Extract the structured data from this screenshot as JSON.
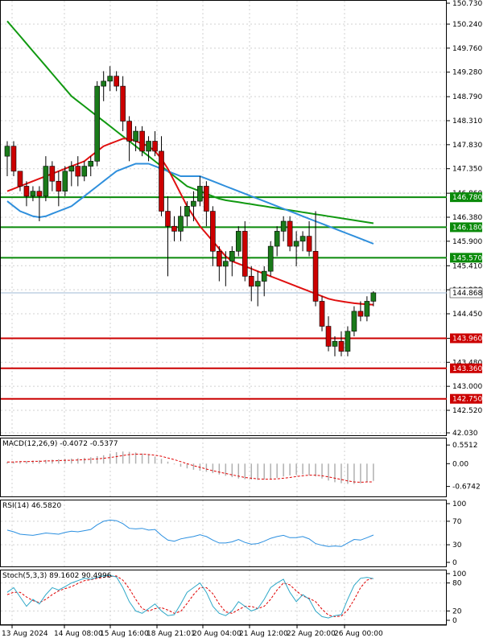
{
  "colors": {
    "bull": "#1a7a1a",
    "bear": "#cc0000",
    "ma_fast": "#e01010",
    "ma_mid": "#2f8fdc",
    "ma_slow": "#119911",
    "resistance": "#0a8a0a",
    "support": "#cc0000",
    "current_price": "#9fb8d6",
    "rsi_line": "#2a8fe0",
    "stoch_main": "#2fa8c8",
    "stoch_signal": "#e00000",
    "macd_hist": "#b0b0b0",
    "macd_signal": "#e00000",
    "grid": "#d0d0d0"
  },
  "chart_data": [
    {
      "type": "candlestick",
      "pane": "price",
      "ylim": [
        42.03,
        150.73
      ],
      "y_ticks": [
        "150.730",
        "150.240",
        "149.760",
        "149.280",
        "148.790",
        "148.310",
        "147.830",
        "147.350",
        "146.860",
        "146.380",
        "145.900",
        "145.410",
        "144.930",
        "144.450",
        "143.960",
        "143.480",
        "143.000",
        "142.520",
        "42.030"
      ],
      "x_labels": [
        "13 Aug 2024",
        "14 Aug 08:00",
        "15 Aug 16:00",
        "18 Aug 21:01",
        "20 Aug 04:00",
        "21 Aug 12:00",
        "22 Aug 20:00",
        "26 Aug 00:00"
      ],
      "candles": [
        [
          147.6,
          147.9,
          147.2,
          147.8
        ],
        [
          147.8,
          147.9,
          147.2,
          147.3
        ],
        [
          147.3,
          147.3,
          146.9,
          147.0
        ],
        [
          147.0,
          147.1,
          146.6,
          146.8
        ],
        [
          146.8,
          147.0,
          146.7,
          146.9
        ],
        [
          146.9,
          147.0,
          146.3,
          146.8
        ],
        [
          146.8,
          147.6,
          146.7,
          147.4
        ],
        [
          147.4,
          147.5,
          146.9,
          147.1
        ],
        [
          147.1,
          147.3,
          146.6,
          146.9
        ],
        [
          146.9,
          147.4,
          146.8,
          147.3
        ],
        [
          147.3,
          147.5,
          147.0,
          147.4
        ],
        [
          147.4,
          147.6,
          147.0,
          147.2
        ],
        [
          147.2,
          147.5,
          147.1,
          147.4
        ],
        [
          147.4,
          147.6,
          147.2,
          147.5
        ],
        [
          147.5,
          149.1,
          147.4,
          149.0
        ],
        [
          149.0,
          149.3,
          148.7,
          149.1
        ],
        [
          149.1,
          149.4,
          148.9,
          149.2
        ],
        [
          149.2,
          149.3,
          148.9,
          149.0
        ],
        [
          149.0,
          149.2,
          148.1,
          148.3
        ],
        [
          148.3,
          148.4,
          147.5,
          147.9
        ],
        [
          147.9,
          148.2,
          147.7,
          148.1
        ],
        [
          148.1,
          148.2,
          147.6,
          147.7
        ],
        [
          147.7,
          148.0,
          147.5,
          147.9
        ],
        [
          147.9,
          148.1,
          147.6,
          147.7
        ],
        [
          147.7,
          148.0,
          146.4,
          146.5
        ],
        [
          146.5,
          146.8,
          145.2,
          146.2
        ],
        [
          146.2,
          146.4,
          145.9,
          146.1
        ],
        [
          146.1,
          146.6,
          145.9,
          146.4
        ],
        [
          146.4,
          146.7,
          146.2,
          146.6
        ],
        [
          146.6,
          146.9,
          146.3,
          146.7
        ],
        [
          146.7,
          147.2,
          146.6,
          147.0
        ],
        [
          147.0,
          147.1,
          146.2,
          146.5
        ],
        [
          146.5,
          146.6,
          145.4,
          145.7
        ],
        [
          145.7,
          145.8,
          145.1,
          145.4
        ],
        [
          145.4,
          145.7,
          145.0,
          145.5
        ],
        [
          145.5,
          145.8,
          145.2,
          145.7
        ],
        [
          145.7,
          146.2,
          145.6,
          146.1
        ],
        [
          146.1,
          146.3,
          145.1,
          145.2
        ],
        [
          145.2,
          145.4,
          144.7,
          145.0
        ],
        [
          145.0,
          145.3,
          144.6,
          145.1
        ],
        [
          145.1,
          145.4,
          144.8,
          145.3
        ],
        [
          145.3,
          145.9,
          145.2,
          145.8
        ],
        [
          145.8,
          146.2,
          145.6,
          146.1
        ],
        [
          146.1,
          146.4,
          145.9,
          146.3
        ],
        [
          146.3,
          146.4,
          145.7,
          145.8
        ],
        [
          145.8,
          146.1,
          145.4,
          145.9
        ],
        [
          145.9,
          146.1,
          145.7,
          146.0
        ],
        [
          146.0,
          146.3,
          145.6,
          145.7
        ],
        [
          145.7,
          146.5,
          144.6,
          144.7
        ],
        [
          144.7,
          144.8,
          144.1,
          144.2
        ],
        [
          144.2,
          144.4,
          143.7,
          143.8
        ],
        [
          143.8,
          144.0,
          143.6,
          143.9
        ],
        [
          143.9,
          144.1,
          143.6,
          143.7
        ],
        [
          143.7,
          144.2,
          143.6,
          144.1
        ],
        [
          144.1,
          144.6,
          144.0,
          144.5
        ],
        [
          144.5,
          144.7,
          144.3,
          144.4
        ],
        [
          144.4,
          144.8,
          144.3,
          144.7
        ],
        [
          144.7,
          144.9,
          144.6,
          144.87
        ]
      ],
      "ma_fast": [
        146.9,
        146.95,
        147.0,
        147.05,
        147.1,
        147.15,
        147.2,
        147.25,
        147.3,
        147.35,
        147.4,
        147.45,
        147.5,
        147.6,
        147.7,
        147.8,
        147.85,
        147.9,
        147.95,
        147.95,
        147.9,
        147.85,
        147.8,
        147.7,
        147.55,
        147.35,
        147.1,
        146.85,
        146.6,
        146.4,
        146.2,
        146.05,
        145.9,
        145.75,
        145.6,
        145.5,
        145.45,
        145.4,
        145.35,
        145.3,
        145.25,
        145.2,
        145.15,
        145.1,
        145.05,
        145.0,
        144.95,
        144.9,
        144.85,
        144.8,
        144.75,
        144.72,
        144.7,
        144.68,
        144.66,
        144.65,
        144.64,
        144.63
      ],
      "ma_mid": [
        146.7,
        146.6,
        146.5,
        146.45,
        146.4,
        146.38,
        146.4,
        146.45,
        146.5,
        146.55,
        146.6,
        146.7,
        146.8,
        146.9,
        147.0,
        147.1,
        147.2,
        147.3,
        147.35,
        147.4,
        147.45,
        147.45,
        147.45,
        147.4,
        147.35,
        147.3,
        147.25,
        147.2,
        147.2,
        147.2,
        147.2,
        147.15,
        147.1,
        147.05,
        147.0,
        146.95,
        146.9,
        146.85,
        146.8,
        146.75,
        146.7,
        146.65,
        146.6,
        146.55,
        146.5,
        146.45,
        146.4,
        146.35,
        146.3,
        146.25,
        146.2,
        146.15,
        146.1,
        146.05,
        146.0,
        145.95,
        145.9,
        145.85
      ],
      "ma_slow": [
        150.3,
        150.15,
        150.0,
        149.85,
        149.7,
        149.55,
        149.4,
        149.25,
        149.1,
        148.95,
        148.8,
        148.7,
        148.6,
        148.5,
        148.4,
        148.3,
        148.2,
        148.1,
        148.0,
        147.9,
        147.8,
        147.7,
        147.6,
        147.5,
        147.4,
        147.3,
        147.2,
        147.1,
        147.0,
        146.95,
        146.9,
        146.85,
        146.8,
        146.75,
        146.72,
        146.7,
        146.68,
        146.66,
        146.64,
        146.62,
        146.6,
        146.58,
        146.56,
        146.54,
        146.52,
        146.5,
        146.48,
        146.46,
        146.44,
        146.42,
        146.4,
        146.38,
        146.36,
        146.34,
        146.32,
        146.3,
        146.28,
        146.26
      ],
      "levels": [
        {
          "label": "146.780",
          "value": 146.78,
          "kind": "resistance"
        },
        {
          "label": "146.180",
          "value": 146.18,
          "kind": "resistance"
        },
        {
          "label": "145.570",
          "value": 145.57,
          "kind": "resistance"
        },
        {
          "label": "143.960",
          "value": 143.96,
          "kind": "support"
        },
        {
          "label": "143.360",
          "value": 143.36,
          "kind": "support"
        },
        {
          "label": "142.750",
          "value": 142.75,
          "kind": "support"
        }
      ],
      "current_price": {
        "label": "144.868",
        "value": 144.868
      }
    },
    {
      "type": "macd",
      "pane": "macd",
      "title": "MACD(12,26,9) -0.4072 -0.5377",
      "y_ticks": [
        "0.5512",
        "0.00",
        "-0.6742"
      ],
      "ylim": [
        -0.85,
        0.65
      ],
      "hist": [
        0.05,
        0.06,
        0.07,
        0.08,
        0.09,
        0.1,
        0.11,
        0.12,
        0.13,
        0.14,
        0.15,
        0.16,
        0.17,
        0.19,
        0.22,
        0.25,
        0.3,
        0.34,
        0.36,
        0.35,
        0.33,
        0.3,
        0.26,
        0.21,
        0.14,
        0.06,
        -0.02,
        -0.09,
        -0.14,
        -0.18,
        -0.21,
        -0.24,
        -0.28,
        -0.32,
        -0.36,
        -0.4,
        -0.44,
        -0.46,
        -0.47,
        -0.48,
        -0.47,
        -0.45,
        -0.42,
        -0.38,
        -0.35,
        -0.33,
        -0.32,
        -0.34,
        -0.38,
        -0.44,
        -0.5,
        -0.55,
        -0.58,
        -0.6,
        -0.6,
        -0.58,
        -0.55,
        -0.51
      ],
      "signal": [
        0.05,
        0.05,
        0.06,
        0.06,
        0.07,
        0.07,
        0.08,
        0.08,
        0.09,
        0.1,
        0.1,
        0.11,
        0.12,
        0.13,
        0.14,
        0.16,
        0.18,
        0.21,
        0.24,
        0.27,
        0.28,
        0.28,
        0.27,
        0.25,
        0.22,
        0.17,
        0.12,
        0.06,
        0.0,
        -0.06,
        -0.11,
        -0.16,
        -0.21,
        -0.25,
        -0.29,
        -0.33,
        -0.37,
        -0.41,
        -0.43,
        -0.45,
        -0.46,
        -0.46,
        -0.45,
        -0.43,
        -0.41,
        -0.38,
        -0.36,
        -0.34,
        -0.34,
        -0.36,
        -0.39,
        -0.43,
        -0.47,
        -0.51,
        -0.54,
        -0.55,
        -0.54,
        -0.54
      ]
    },
    {
      "type": "line",
      "pane": "rsi",
      "title": "RSI(14) 46.5820",
      "y_ticks": [
        "100",
        "70",
        "30",
        "0"
      ],
      "ylim": [
        0,
        100
      ],
      "values": [
        55,
        52,
        48,
        47,
        46,
        48,
        50,
        49,
        48,
        51,
        53,
        52,
        54,
        56,
        64,
        70,
        72,
        71,
        66,
        58,
        57,
        58,
        55,
        56,
        46,
        38,
        36,
        40,
        42,
        44,
        47,
        44,
        38,
        33,
        33,
        35,
        39,
        34,
        31,
        32,
        36,
        41,
        44,
        46,
        42,
        42,
        44,
        40,
        32,
        29,
        27,
        28,
        27,
        33,
        39,
        38,
        42,
        46.58
      ]
    },
    {
      "type": "line",
      "pane": "stoch",
      "title": "Stoch(5,3,3) 89.1602 90.4996",
      "y_ticks": [
        "100",
        "80",
        "20",
        "0"
      ],
      "ylim": [
        0,
        100
      ],
      "main": [
        60,
        70,
        50,
        30,
        45,
        35,
        55,
        70,
        65,
        72,
        80,
        85,
        90,
        88,
        92,
        95,
        96,
        93,
        70,
        40,
        20,
        15,
        25,
        35,
        20,
        10,
        12,
        35,
        60,
        70,
        80,
        60,
        30,
        15,
        10,
        20,
        40,
        30,
        20,
        25,
        45,
        70,
        80,
        88,
        60,
        40,
        55,
        45,
        20,
        8,
        5,
        10,
        12,
        45,
        75,
        90,
        92,
        89.16
      ],
      "signal": [
        55,
        60,
        60,
        50,
        42,
        38,
        45,
        55,
        63,
        68,
        72,
        79,
        85,
        87,
        90,
        92,
        94,
        95,
        86,
        68,
        45,
        25,
        20,
        25,
        27,
        22,
        15,
        19,
        36,
        55,
        70,
        70,
        57,
        35,
        18,
        15,
        23,
        30,
        30,
        25,
        30,
        45,
        65,
        80,
        76,
        63,
        52,
        47,
        40,
        24,
        11,
        8,
        9,
        22,
        44,
        70,
        86,
        90.5
      ]
    }
  ]
}
